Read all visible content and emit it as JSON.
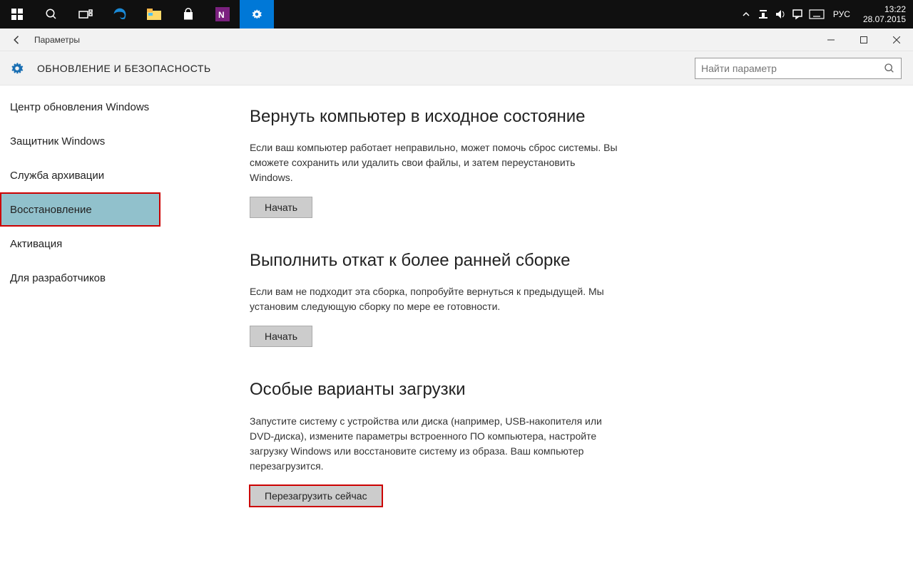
{
  "taskbar": {
    "lang": "РУС",
    "time": "13:22",
    "date": "28.07.2015"
  },
  "titlebar": {
    "title": "Параметры"
  },
  "subheader": {
    "title": "ОБНОВЛЕНИЕ И БЕЗОПАСНОСТЬ",
    "search_placeholder": "Найти параметр"
  },
  "sidebar": {
    "items": [
      {
        "label": "Центр обновления Windows"
      },
      {
        "label": "Защитник Windows"
      },
      {
        "label": "Служба архивации"
      },
      {
        "label": "Восстановление"
      },
      {
        "label": "Активация"
      },
      {
        "label": "Для разработчиков"
      }
    ]
  },
  "main": {
    "sections": [
      {
        "heading": "Вернуть компьютер в исходное состояние",
        "body": "Если ваш компьютер работает неправильно, может помочь сброс системы. Вы сможете сохранить или удалить свои файлы, и затем переустановить Windows.",
        "button": "Начать"
      },
      {
        "heading": "Выполнить откат к более ранней сборке",
        "body": "Если вам не подходит эта сборка, попробуйте вернуться к предыдущей. Мы установим следующую сборку по мере ее готовности.",
        "button": "Начать"
      },
      {
        "heading": "Особые варианты загрузки",
        "body": "Запустите систему с устройства или диска (например, USB-накопителя или DVD-диска), измените параметры встроенного ПО компьютера, настройте загрузку Windows или восстановите систему из образа. Ваш компьютер перезагрузится.",
        "button": "Перезагрузить сейчас"
      }
    ]
  }
}
